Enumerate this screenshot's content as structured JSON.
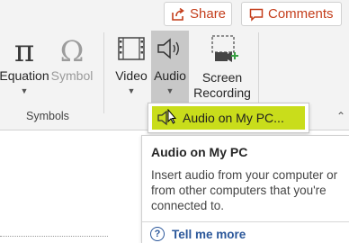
{
  "header": {
    "share_label": "Share",
    "comments_label": "Comments"
  },
  "symbols_group": {
    "equation_glyph": "π",
    "equation_label": "Equation",
    "symbol_glyph": "Ω",
    "symbol_label": "Symbol",
    "group_label": "Symbols"
  },
  "media_group": {
    "video_label": "Video",
    "audio_label": "Audio",
    "screen_recording_label_1": "Screen",
    "screen_recording_label_2": "Recording"
  },
  "audio_menu": {
    "item_label": "Audio on My PC..."
  },
  "tooltip": {
    "title": "Audio on My PC",
    "description": "Insert audio from your computer or from other computers that you're connected to.",
    "help_link": "Tell me more"
  },
  "icons": {
    "share": "share-icon",
    "comments": "comment-icon",
    "video": "film-strip-icon",
    "audio": "speaker-icon",
    "screen_recording": "camera-record-icon",
    "help": "question-circle-icon"
  },
  "colors": {
    "accent": "#c43e1c",
    "highlight": "#c9dd1b",
    "link": "#2b579a",
    "ribbon_bg": "#f3f3f3"
  }
}
